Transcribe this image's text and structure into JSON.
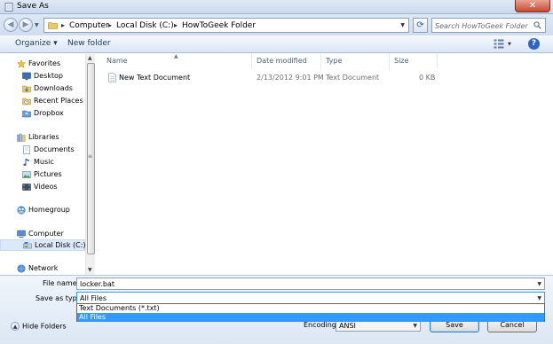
{
  "window": {
    "title": "Save As",
    "close_glyph": "✕"
  },
  "address": {
    "crumbs": [
      "Computer",
      "Local Disk (C:)",
      "HowToGeek Folder"
    ],
    "separator": "▸",
    "back_glyph": "◀",
    "forward_glyph": "▶",
    "refresh_glyph": "⟳"
  },
  "search": {
    "placeholder": "Search HowToGeek Folder"
  },
  "toolbar": {
    "organize_label": "Organize ▾",
    "new_folder_label": "New folder",
    "help_glyph": "?"
  },
  "nav": {
    "favorites": {
      "label": "Favorites",
      "items": [
        "Desktop",
        "Downloads",
        "Recent Places",
        "Dropbox"
      ]
    },
    "libraries": {
      "label": "Libraries",
      "items": [
        "Documents",
        "Music",
        "Pictures",
        "Videos"
      ]
    },
    "homegroup": {
      "label": "Homegroup"
    },
    "computer": {
      "label": "Computer",
      "items": [
        "Local Disk (C:)"
      ]
    },
    "network": {
      "label": "Network"
    }
  },
  "filelist": {
    "columns": [
      "Name",
      "Date modified",
      "Type",
      "Size"
    ],
    "rows": [
      {
        "name": "New Text Document",
        "date": "2/13/2012 9:01 PM",
        "type": "Text Document",
        "size": "0 KB"
      }
    ]
  },
  "form": {
    "file_name_label": "File name:",
    "file_name_value": "locker.bat",
    "save_as_type_label": "Save as type:",
    "save_as_type_value": "All Files",
    "type_options": [
      "Text Documents (*.txt)",
      "All Files"
    ],
    "selected_option": "All Files",
    "encoding_label": "Encoding:",
    "encoding_value": "ANSI"
  },
  "buttons": {
    "save": "Save",
    "cancel": "Cancel",
    "hide_folders": "Hide Folders",
    "hide_folders_glyph": "▲"
  },
  "colors": {
    "selection": "#3399ff",
    "chrome": "#dce7f4",
    "close": "#c74a33"
  }
}
